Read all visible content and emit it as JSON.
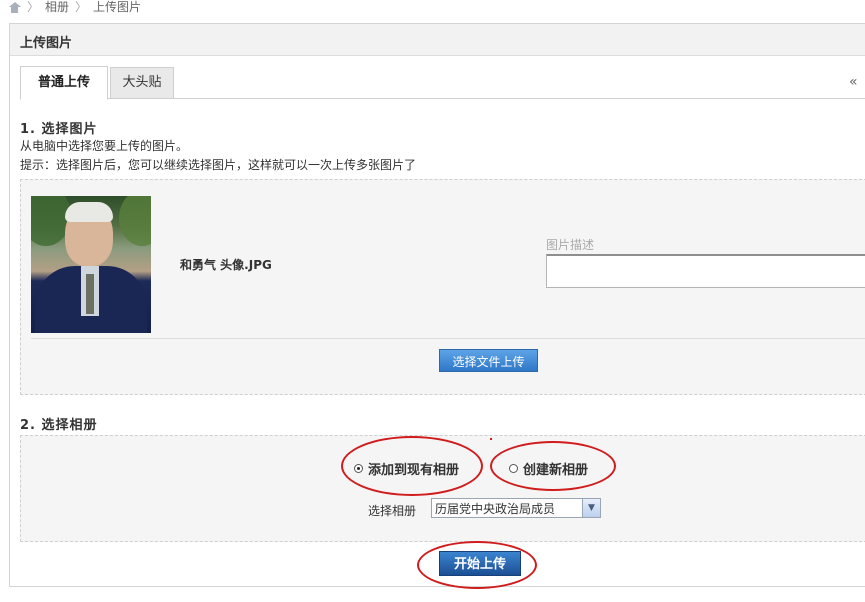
{
  "breadcrumb": {
    "items": [
      "相册",
      "上传图片"
    ],
    "home_icon": "home-icon",
    "separator": "〉"
  },
  "panel": {
    "title": "上传图片"
  },
  "tabs": [
    {
      "label": "普通上传",
      "active": true
    },
    {
      "label": "大头贴",
      "active": false
    }
  ],
  "tab_more": "«",
  "section1": {
    "title": "1. 选择图片",
    "desc": "从电脑中选择您要上传的图片。",
    "hint": "提示：选择图片后，您可以继续选择图片，这样就可以一次上传多张图片了"
  },
  "upload": {
    "filename": "和勇气 头像.JPG",
    "desc_label": "图片描述",
    "desc_value": "",
    "select_file_button": "选择文件上传"
  },
  "section2": {
    "title": "2. 选择相册",
    "options": [
      {
        "label": "添加到现有相册",
        "checked": true
      },
      {
        "label": "创建新相册",
        "checked": false
      }
    ],
    "choose_label": "选择相册",
    "album_selected": "历届党中央政治局成员"
  },
  "start_button": "开始上传",
  "colors": {
    "annotation": "#d01c1c",
    "button": "#2f78c8",
    "panel_header": "#f2f2f2"
  }
}
